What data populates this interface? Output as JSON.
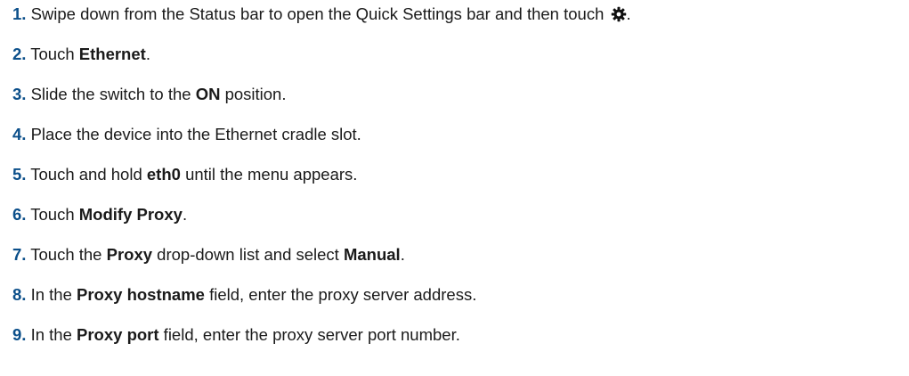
{
  "steps": [
    {
      "num": "1.",
      "text_before": "Swipe down from the Status bar to open the Quick Settings bar and then touch",
      "icon": "gear-icon",
      "text_after": "."
    },
    {
      "num": "2.",
      "pre": "Touch ",
      "bold": "Ethernet",
      "post": "."
    },
    {
      "num": "3.",
      "pre": "Slide the switch to the ",
      "bold": "ON",
      "post": " position."
    },
    {
      "num": "4.",
      "text": "Place the device into the Ethernet cradle slot."
    },
    {
      "num": "5.",
      "pre": "Touch and hold ",
      "bold": "eth0",
      "post": " until the menu appears."
    },
    {
      "num": "6.",
      "pre": "Touch ",
      "bold": "Modify Proxy",
      "post": "."
    },
    {
      "num": "7.",
      "pre": "Touch the ",
      "bold": "Proxy",
      "mid": " drop-down list and select ",
      "bold2": "Manual",
      "post": "."
    },
    {
      "num": "8.",
      "pre": "In the ",
      "bold": "Proxy hostname",
      "post": " field, enter the proxy server address."
    },
    {
      "num": "9.",
      "pre": "In the ",
      "bold": "Proxy port",
      "post": " field, enter the proxy server port number."
    }
  ]
}
